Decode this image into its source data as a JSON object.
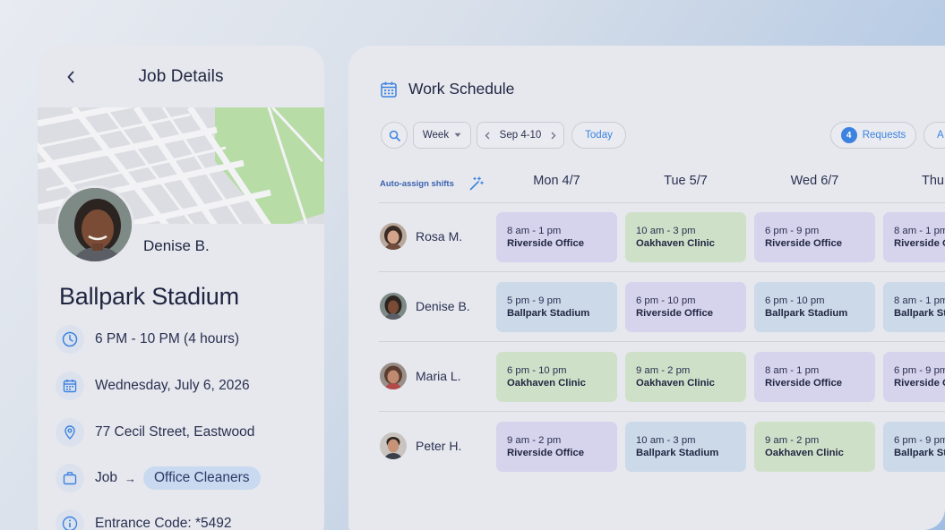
{
  "job_details": {
    "title": "Job Details",
    "person_name": "Denise B.",
    "venue": "Ballpark Stadium",
    "time": "6 PM - 10 PM (4 hours)",
    "date": "Wednesday, July 6, 2026",
    "address": "77 Cecil Street, Eastwood",
    "job_label": "Job",
    "job_arrow": "→",
    "job_tag": "Office Cleaners",
    "entrance_code": "Entrance Code: *5492",
    "icons": [
      "chevron-left-icon",
      "clock-icon",
      "calendar-icon",
      "location-pin-icon",
      "briefcase-icon",
      "info-icon"
    ]
  },
  "schedule": {
    "title": "Work Schedule",
    "view_select": "Week",
    "date_range": "Sep 4-10",
    "today_label": "Today",
    "requests_count": "4",
    "requests_label": "Requests",
    "extra_button_label": "A",
    "auto_assign_label": "Auto-assign shifts",
    "days": [
      "Mon 4/7",
      "Tue 5/7",
      "Wed 6/7",
      "Thu"
    ],
    "employees": [
      {
        "name": "Rosa M.",
        "shifts": [
          {
            "time": "8 am - 1 pm",
            "location": "Riverside Office"
          },
          {
            "time": "10 am - 3 pm",
            "location": "Oakhaven Clinic"
          },
          {
            "time": "6 pm - 9 pm",
            "location": "Riverside Office"
          },
          {
            "time": "8 am - 1 pm",
            "location": "Riverside Office"
          }
        ]
      },
      {
        "name": "Denise B.",
        "shifts": [
          {
            "time": "5 pm - 9 pm",
            "location": "Ballpark Stadium"
          },
          {
            "time": "6 pm - 10 pm",
            "location": "Riverside Office"
          },
          {
            "time": "6 pm - 10 pm",
            "location": "Ballpark Stadium"
          },
          {
            "time": "8 am - 1 pm",
            "location": "Ballpark Stadium"
          }
        ]
      },
      {
        "name": "Maria L.",
        "shifts": [
          {
            "time": "6 pm - 10 pm",
            "location": "Oakhaven Clinic"
          },
          {
            "time": "9 am - 2 pm",
            "location": "Oakhaven Clinic"
          },
          {
            "time": "8 am - 1 pm",
            "location": "Riverside Office"
          },
          {
            "time": "6 pm - 9 pm",
            "location": "Riverside Office"
          }
        ]
      },
      {
        "name": "Peter H.",
        "shifts": [
          {
            "time": "9 am - 2 pm",
            "location": "Riverside Office"
          },
          {
            "time": "10 am - 3 pm",
            "location": "Ballpark Stadium"
          },
          {
            "time": "9 am - 2 pm",
            "location": "Oakhaven Clinic"
          },
          {
            "time": "6 pm - 9 pm",
            "location": "Ballpark Stadium"
          }
        ]
      }
    ]
  },
  "colors": {
    "accent": "#3c82e0",
    "riverside": "#d6d3ec",
    "oakhaven": "#cfe0c8",
    "ballpark": "#cbd9e9",
    "map_park": "#b7dca6"
  }
}
